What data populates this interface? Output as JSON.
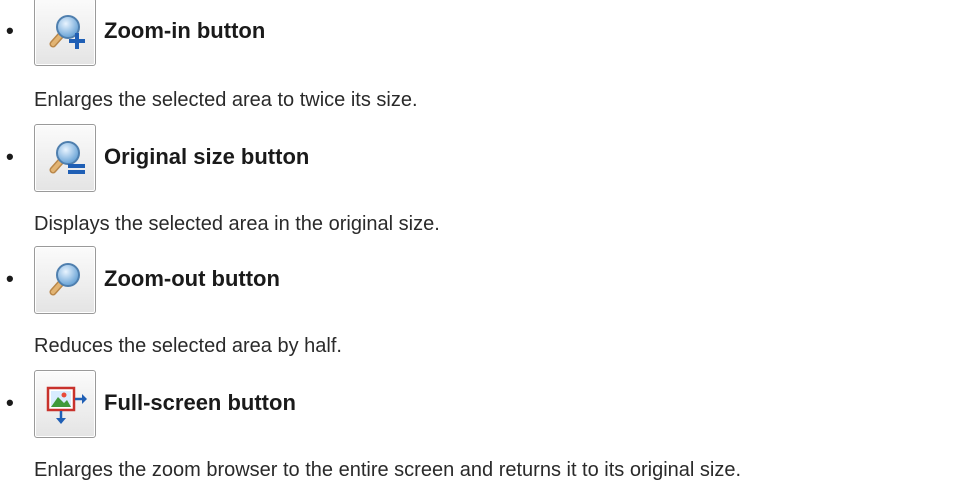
{
  "items": [
    {
      "title": "Zoom-in button",
      "icon": "zoom-in-icon",
      "description": "Enlarges the selected area to twice its size."
    },
    {
      "title": "Original size button",
      "icon": "original-size-icon",
      "description": "Displays the selected area in the original size."
    },
    {
      "title": "Zoom-out button",
      "icon": "zoom-out-icon",
      "description": "Reduces the selected area by half."
    },
    {
      "title": "Full-screen button",
      "icon": "full-screen-icon",
      "description": "Enlarges the zoom browser to the entire screen and returns it to its original size."
    }
  ],
  "colors": {
    "lens": "#6fa7d8",
    "handle": "#d9a55e",
    "accent_blue": "#1f5fb5",
    "frame_red": "#c8322c",
    "image_green": "#3f9a3a"
  }
}
